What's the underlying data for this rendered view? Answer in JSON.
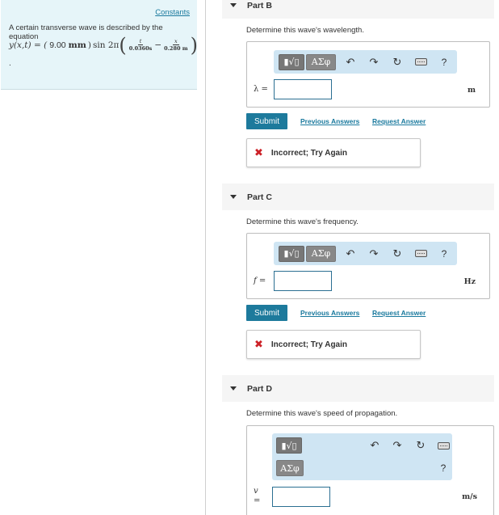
{
  "problem": {
    "constants_link": "Constants",
    "intro": "A certain transverse wave is described by the equation",
    "equation": {
      "lhs": "y(x,t) = (",
      "amplitude": "9.00",
      "amp_unit": "mm",
      "close_paren": ")",
      "sin": "sin 2π",
      "t_num": "t",
      "t_den": "0.0360s",
      "minus": "−",
      "x_num": "x",
      "x_den": "0.280 m"
    },
    "trailing": "."
  },
  "toolbar": {
    "radical": "▮√▯",
    "greek": "ΑΣφ",
    "undo": "↶",
    "redo": "↷",
    "reset": "↻",
    "help": "?"
  },
  "parts": {
    "b": {
      "title": "Part B",
      "question": "Determine this wave's wavelength.",
      "var_label": "λ =",
      "input_value": "",
      "unit": "m",
      "submit": "Submit",
      "previous": "Previous Answers",
      "request": "Request Answer",
      "feedback": "Incorrect; Try Again"
    },
    "c": {
      "title": "Part C",
      "question": "Determine this wave's frequency.",
      "var_label": "f =",
      "input_value": "",
      "unit": "Hz",
      "submit": "Submit",
      "previous": "Previous Answers",
      "request": "Request Answer",
      "feedback": "Incorrect; Try Again"
    },
    "d": {
      "title": "Part D",
      "question": "Determine this wave's speed of propagation.",
      "var_label": "v",
      "var_eq": "=",
      "input_value": "",
      "unit": "m/s"
    }
  },
  "colors": {
    "accent": "#1d7a9c",
    "panel_bg": "#e6f5f9",
    "toolbar_bg": "#cfe5f3",
    "error": "#cc2127"
  }
}
